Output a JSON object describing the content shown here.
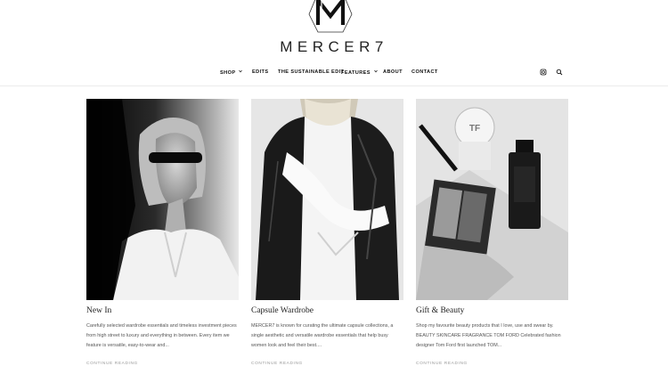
{
  "brand": {
    "logo_letter": "M",
    "wordmark": "MERCER7"
  },
  "nav": {
    "items": [
      {
        "label": "SHOP",
        "has_dropdown": true
      },
      {
        "label": "EDITS",
        "has_dropdown": false
      },
      {
        "label": "THE SUSTAINABLE EDIT",
        "has_dropdown": false
      },
      {
        "label": "FEATURES",
        "has_dropdown": true
      },
      {
        "label": "ABOUT",
        "has_dropdown": false
      },
      {
        "label": "CONTACT",
        "has_dropdown": false
      }
    ],
    "icons": [
      "instagram-icon",
      "search-icon"
    ]
  },
  "cards": [
    {
      "title": "New In",
      "excerpt": "Carefully selected wardrobe essentials and timeless investment pieces from high street to luxury and everything in between. Every item we feature is versatile, easy-to-wear and...",
      "more": "CONTINUE READING",
      "image": "black-and-white-woman-sunglasses-white-blazer"
    },
    {
      "title": "Capsule Wardrobe",
      "excerpt": "MERCER7 is known for curating the ultimate capsule collections, a single aesthetic and versatile wardrobe essentials that help busy women look and feel their best....",
      "more": "CONTINUE READING",
      "image": "black-and-white-woman-leather-jacket-white-shirt"
    },
    {
      "title": "Gift & Beauty",
      "excerpt": "Shop my favourite beauty products that I love, use and swear by. BEAUTY SKINCARE FRAGRANCE TOM FORD Celebrated fashion designer Tom Ford first launched TOM...",
      "more": "CONTINUE READING",
      "image": "black-and-white-tom-ford-beauty-products"
    }
  ]
}
